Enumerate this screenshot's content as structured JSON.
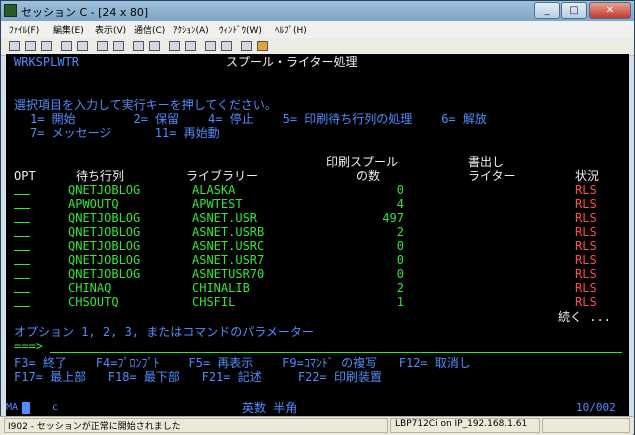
{
  "window": {
    "title": "セッション C - [24 x 80]",
    "minimize": "_",
    "maximize": "□",
    "close": "✕"
  },
  "menu": [
    "ﾌｧｲﾙ(F)",
    "編集(E)",
    "表示(V)",
    "通信(C)",
    "ｱｸｼｮﾝ(A)",
    "ｳｨﾝﾄﾞｳ(W)",
    "ﾍﾙﾌﾟ(H)"
  ],
  "screen": {
    "command": "WRKSPLWTR",
    "title": "スプール・ライター処理",
    "instruction": "選択項目を入力して実行キーを押してください。",
    "options_line1": "1= 開始        2= 保留    4= 停止    5= 印刷待ち行列の処理    6= 解放",
    "options_line2": "7= メッセージ      11= 再始動",
    "headers": {
      "opt": "OPT",
      "queue": "待ち行列",
      "library": "ライブラリー",
      "spool_top": "印刷スプール",
      "spool_bottom": "の数",
      "writer_top": "書出し",
      "writer_bottom": "ライター",
      "status": "状況"
    },
    "rows": [
      {
        "queue": "QNETJOBLOG",
        "library": "ALASKA",
        "count": "0",
        "writer": "",
        "status": "RLS"
      },
      {
        "queue": "APWOUTQ",
        "library": "APWTEST",
        "count": "4",
        "writer": "",
        "status": "RLS"
      },
      {
        "queue": "QNETJOBLOG",
        "library": "ASNET.USR",
        "count": "497",
        "writer": "",
        "status": "RLS"
      },
      {
        "queue": "QNETJOBLOG",
        "library": "ASNET.USRB",
        "count": "2",
        "writer": "",
        "status": "RLS"
      },
      {
        "queue": "QNETJOBLOG",
        "library": "ASNET.USRC",
        "count": "0",
        "writer": "",
        "status": "RLS"
      },
      {
        "queue": "QNETJOBLOG",
        "library": "ASNET.USR7",
        "count": "0",
        "writer": "",
        "status": "RLS"
      },
      {
        "queue": "QNETJOBLOG",
        "library": "ASNETUSR70",
        "count": "0",
        "writer": "",
        "status": "RLS"
      },
      {
        "queue": "CHINAQ",
        "library": "CHINALIB",
        "count": "2",
        "writer": "",
        "status": "RLS"
      },
      {
        "queue": "CHSOUTQ",
        "library": "CHSFIL",
        "count": "1",
        "writer": "",
        "status": "RLS"
      }
    ],
    "more": "続く ...",
    "params_prompt": "オプション 1, 2, 3, またはコマンドのパラメーター",
    "arrow": "===>",
    "command_value": "",
    "fkeys_line1": "F3= 終了    F4=ﾌﾟﾛﾝﾌﾟﾄ    F5= 再表示    F9=ｺﾏﾝﾄﾞ の複写   F12= 取消し",
    "fkeys_line2": "F17= 最上部   F18= 最下部   F21= 記述     F22= 印刷装置"
  },
  "oia": {
    "ma": "MA",
    "mode": "c",
    "input_mode": "英数 半角",
    "position": "10/002"
  },
  "statusbar": {
    "message": "I902 - セッションが正常に開始されました",
    "connection": "LBP712Ci on IP_192.168.1.61"
  }
}
